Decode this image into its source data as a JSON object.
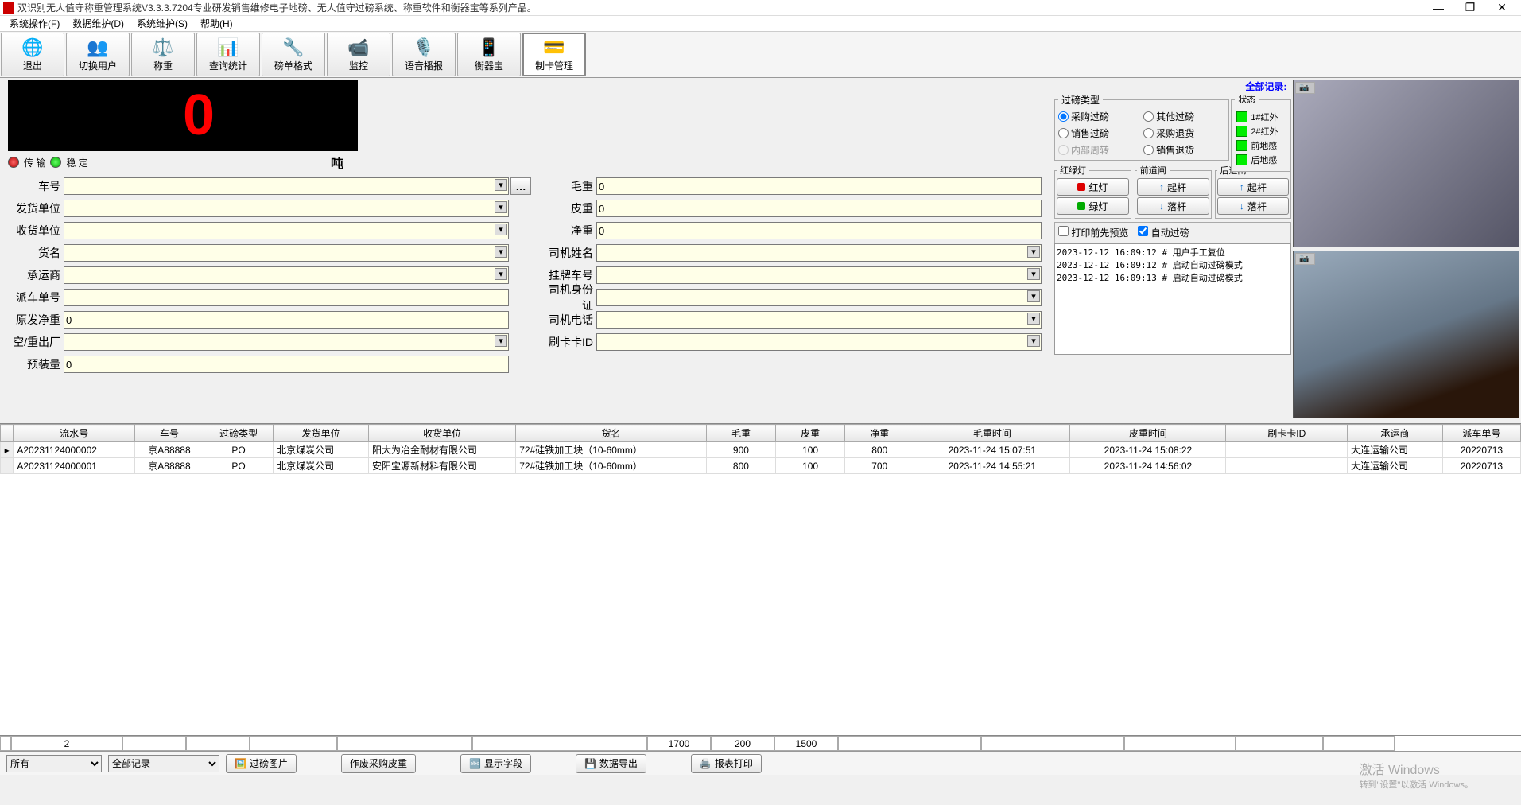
{
  "window": {
    "title": "双识别无人值守称重管理系统V3.3.3.7204专业研发销售维修电子地磅、无人值守过磅系统、称重软件和衡器宝等系列产品。"
  },
  "menu": [
    "系统操作(F)",
    "数据维护(D)",
    "系统维护(S)",
    "帮助(H)"
  ],
  "toolbar": [
    {
      "icon": "🌐",
      "label": "退出"
    },
    {
      "icon": "👥",
      "label": "切换用户"
    },
    {
      "icon": "⚖️",
      "label": "称重"
    },
    {
      "icon": "📊",
      "label": "查询统计"
    },
    {
      "icon": "🔧",
      "label": "磅单格式"
    },
    {
      "icon": "📹",
      "label": "监控"
    },
    {
      "icon": "🎙️",
      "label": "语音播报"
    },
    {
      "icon": "📱",
      "label": "衡器宝"
    },
    {
      "icon": "💳",
      "label": "制卡管理"
    }
  ],
  "weight": {
    "value": "0",
    "unit": "吨",
    "transmit": "传 输",
    "stable": "稳 定"
  },
  "form_left": [
    {
      "label": "车号",
      "type": "combo",
      "value": "",
      "extra_btn": "…"
    },
    {
      "label": "发货单位",
      "type": "combo",
      "value": ""
    },
    {
      "label": "收货单位",
      "type": "combo",
      "value": ""
    },
    {
      "label": "货名",
      "type": "combo",
      "value": ""
    },
    {
      "label": "承运商",
      "type": "combo",
      "value": ""
    },
    {
      "label": "派车单号",
      "type": "text",
      "value": ""
    },
    {
      "label": "原发净重",
      "type": "text",
      "value": "0"
    },
    {
      "label": "空/重出厂",
      "type": "combo",
      "value": ""
    },
    {
      "label": "预装量",
      "type": "text",
      "value": "0"
    }
  ],
  "form_right": [
    {
      "label": "毛重",
      "type": "text",
      "value": "0"
    },
    {
      "label": "皮重",
      "type": "text",
      "value": "0"
    },
    {
      "label": "净重",
      "type": "text",
      "value": "0"
    },
    {
      "label": "司机姓名",
      "type": "combo",
      "value": ""
    },
    {
      "label": "挂牌车号",
      "type": "combo",
      "value": ""
    },
    {
      "label": "司机身份证",
      "type": "combo",
      "value": ""
    },
    {
      "label": "司机电话",
      "type": "combo",
      "value": ""
    },
    {
      "label": "刷卡卡ID",
      "type": "combo",
      "value": ""
    }
  ],
  "all_records_link": "全部记录:",
  "weigh_type": {
    "legend": "过磅类型",
    "opts": [
      "采购过磅",
      "其他过磅",
      "销售过磅",
      "采购退货",
      "内部周转",
      "销售退货"
    ],
    "selected": 0,
    "disabled": [
      4
    ]
  },
  "status_lights": {
    "legend": "状态",
    "items": [
      "1#红外",
      "2#红外",
      "前地感",
      "后地感"
    ]
  },
  "signal_groups": [
    {
      "legend": "红绿灯",
      "btns": [
        {
          "color": "#d00",
          "label": "红灯"
        },
        {
          "color": "#0a0",
          "label": "绿灯"
        }
      ]
    },
    {
      "legend": "前道闸",
      "btns": [
        {
          "color": "",
          "arrow": "↑",
          "label": "起杆"
        },
        {
          "color": "",
          "arrow": "↓",
          "label": "落杆"
        }
      ]
    },
    {
      "legend": "后道闸",
      "btns": [
        {
          "color": "",
          "arrow": "↑",
          "label": "起杆"
        },
        {
          "color": "",
          "arrow": "↓",
          "label": "落杆"
        }
      ]
    }
  ],
  "checks": [
    {
      "label": "打印前先预览",
      "checked": false
    },
    {
      "label": "自动过磅",
      "checked": true
    }
  ],
  "log": "2023-12-12 16:09:12 # 用户手工复位\n2023-12-12 16:09:12 # 启动自动过磅模式\n2023-12-12 16:09:13 # 启动自动过磅模式",
  "camera_labels": [
    "",
    "  "
  ],
  "grid": {
    "headers": [
      "流水号",
      "车号",
      "过磅类型",
      "发货单位",
      "收货单位",
      "货名",
      "毛重",
      "皮重",
      "净重",
      "毛重时间",
      "皮重时间",
      "刷卡卡ID",
      "承运商",
      "派车单号"
    ],
    "rows": [
      [
        "A20231124000002",
        "京A88888",
        "PO",
        "北京煤炭公司",
        "阳大为冶金耐材有限公司",
        "72#硅铁加工块（10-60mm）",
        "900",
        "100",
        "800",
        "2023-11-24 15:07:51",
        "2023-11-24 15:08:22",
        "",
        "大连运输公司",
        "20220713"
      ],
      [
        "A20231124000001",
        "京A88888",
        "PO",
        "北京煤炭公司",
        "安阳宝源新材料有限公司",
        "72#硅铁加工块（10-60mm）",
        "800",
        "100",
        "700",
        "2023-11-24 14:55:21",
        "2023-11-24 14:56:02",
        "",
        "大连运输公司",
        "20220713"
      ]
    ],
    "totals": {
      "count": "2",
      "gross": "1700",
      "tare": "200",
      "net": "1500"
    }
  },
  "bottom": {
    "filter1": "所有",
    "filter2": "全部记录",
    "btns": [
      "过磅图片",
      "作废采购皮重",
      "显示字段",
      "数据导出",
      "报表打印"
    ],
    "btn_icons": [
      "🖼️",
      "",
      "🔤",
      "💾",
      "🖨️"
    ]
  },
  "watermark": {
    "main": "激活 Windows",
    "sub": "转到\"设置\"以激活 Windows。"
  }
}
